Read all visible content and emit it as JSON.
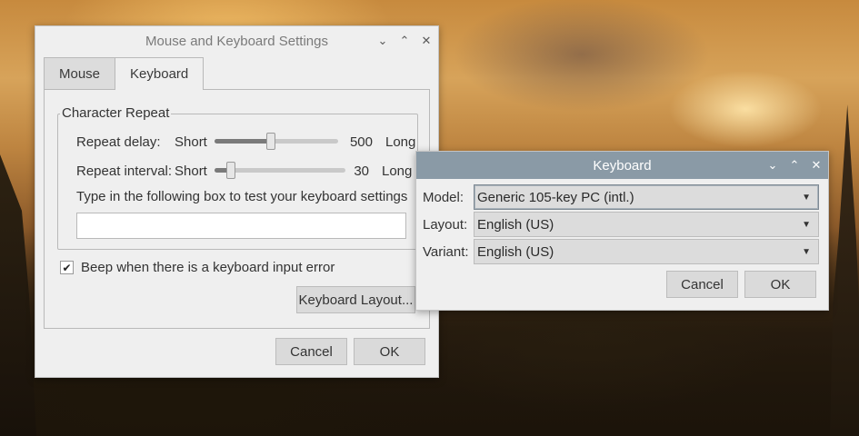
{
  "settings_window": {
    "title": "Mouse and Keyboard Settings",
    "controls": [
      "⌄",
      "⌃",
      "✕"
    ],
    "tabs": [
      {
        "label": "Mouse",
        "active": false
      },
      {
        "label": "Keyboard",
        "active": true
      }
    ],
    "character_repeat": {
      "legend": "Character Repeat",
      "repeat_delay": {
        "label": "Repeat delay:",
        "min_label": "Short",
        "value": "500",
        "max_label": "Long",
        "fraction": 0.45
      },
      "repeat_interval": {
        "label": "Repeat interval:",
        "min_label": "Short",
        "value": "30",
        "max_label": "Long",
        "fraction": 0.1
      },
      "test_prompt": "Type in the following box to test your keyboard settings",
      "test_value": ""
    },
    "beep_checkbox": {
      "label": "Beep when there is a keyboard input error",
      "checked": true,
      "mark": "✔"
    },
    "keyboard_layout_button": "Keyboard Layout...",
    "cancel_button": "Cancel",
    "ok_button": "OK"
  },
  "keyboard_window": {
    "title": "Keyboard",
    "controls": [
      "⌄",
      "⌃",
      "✕"
    ],
    "model": {
      "label": "Model:",
      "value": "Generic 105-key PC (intl.)"
    },
    "layout": {
      "label": "Layout:",
      "value": "English (US)"
    },
    "variant": {
      "label": "Variant:",
      "value": "English (US)"
    },
    "cancel_button": "Cancel",
    "ok_button": "OK"
  },
  "colors": {
    "keyboard_titlebar": "#8a9aa6",
    "window_bg": "#efefef"
  }
}
